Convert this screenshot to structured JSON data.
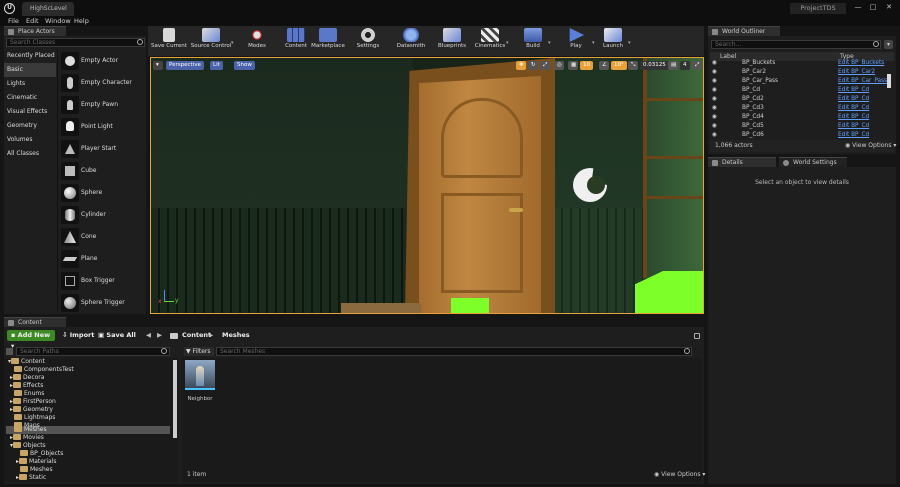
{
  "window": {
    "level_tab": "HighScLevel",
    "project_name": "ProjectTDS",
    "controls": [
      "—",
      "□",
      "✕"
    ]
  },
  "menu": [
    "File",
    "Edit",
    "Window",
    "Help"
  ],
  "place_actors": {
    "tab_label": "Place Actors",
    "search_placeholder": "Search Classes",
    "categories": [
      "Recently Placed",
      "Basic",
      "Lights",
      "Cinematic",
      "Visual Effects",
      "Geometry",
      "Volumes",
      "All Classes"
    ],
    "selected_category": "Basic",
    "actors": [
      "Empty Actor",
      "Empty Character",
      "Empty Pawn",
      "Point Light",
      "Player Start",
      "Cube",
      "Sphere",
      "Cylinder",
      "Cone",
      "Plane",
      "Box Trigger",
      "Sphere Trigger"
    ]
  },
  "toolbar": {
    "buttons": [
      "Save Current",
      "Source Control",
      "Modes",
      "Content",
      "Marketplace",
      "Settings",
      "Datasmith",
      "Blueprints",
      "Cinematics",
      "Build",
      "Play",
      "Launch"
    ]
  },
  "viewport": {
    "view_mode": "Perspective",
    "lighting": "Lit",
    "show": "Show",
    "grid_snap": "10",
    "rotation_snap": "10°",
    "scale_snap": "0.03125",
    "camera_speed": "4",
    "axis_x": "x",
    "axis_y": "y"
  },
  "outliner": {
    "tab_label": "World Outliner",
    "search_placeholder": "Search...",
    "col_label": "Label",
    "col_type": "Type",
    "rows": [
      {
        "name": "BP_Buckets",
        "type": "Edit BP_Buckets"
      },
      {
        "name": "BP_Car2",
        "type": "Edit BP_Car2"
      },
      {
        "name": "BP_Car_Pass",
        "type": "Edit BP_Car_Pass"
      },
      {
        "name": "BP_Cd",
        "type": "Edit BP_Cd"
      },
      {
        "name": "BP_Cd2",
        "type": "Edit BP_Cd"
      },
      {
        "name": "BP_Cd3",
        "type": "Edit BP_Cd"
      },
      {
        "name": "BP_Cd4",
        "type": "Edit BP_Cd"
      },
      {
        "name": "BP_Cd5",
        "type": "Edit BP_Cd"
      },
      {
        "name": "BP_Cd6",
        "type": "Edit BP_Cd"
      }
    ],
    "actor_count": "1,066 actors",
    "view_options": "View Options"
  },
  "details": {
    "tab_details": "Details",
    "tab_world_settings": "World Settings",
    "empty_message": "Select an object to view details"
  },
  "content_browser": {
    "tab_label": "Content Browser",
    "add_new": "Add New",
    "import": "Import",
    "save_all": "Save All",
    "path": [
      "Content",
      "Meshes"
    ],
    "search_paths_placeholder": "Search Paths",
    "filters": "Filters",
    "search_meshes_placeholder": "Search Meshes",
    "tree": [
      {
        "label": "Content",
        "indent": 0,
        "open": true
      },
      {
        "label": "ComponentsTest",
        "indent": 1
      },
      {
        "label": "Decora",
        "indent": 1
      },
      {
        "label": "Effects",
        "indent": 1
      },
      {
        "label": "Enums",
        "indent": 1
      },
      {
        "label": "FirstPerson",
        "indent": 1
      },
      {
        "label": "Geometry",
        "indent": 1
      },
      {
        "label": "Lightmaps",
        "indent": 1
      },
      {
        "label": "Maps",
        "indent": 1
      },
      {
        "label": "Meshes",
        "indent": 1,
        "selected": true
      },
      {
        "label": "Movies",
        "indent": 1
      },
      {
        "label": "Objects",
        "indent": 1,
        "open": true
      },
      {
        "label": "BP_Objects",
        "indent": 2
      },
      {
        "label": "Materials",
        "indent": 2
      },
      {
        "label": "Meshes",
        "indent": 2
      },
      {
        "label": "Static",
        "indent": 2
      }
    ],
    "asset_name": "Neighbor",
    "item_count": "1 item",
    "view_options": "View Options"
  },
  "colors": {
    "accent_orange": "#e8a13a",
    "link_blue": "#5fa0ff",
    "add_new_green": "#3d8a24",
    "neon_green": "#7dff2a"
  }
}
